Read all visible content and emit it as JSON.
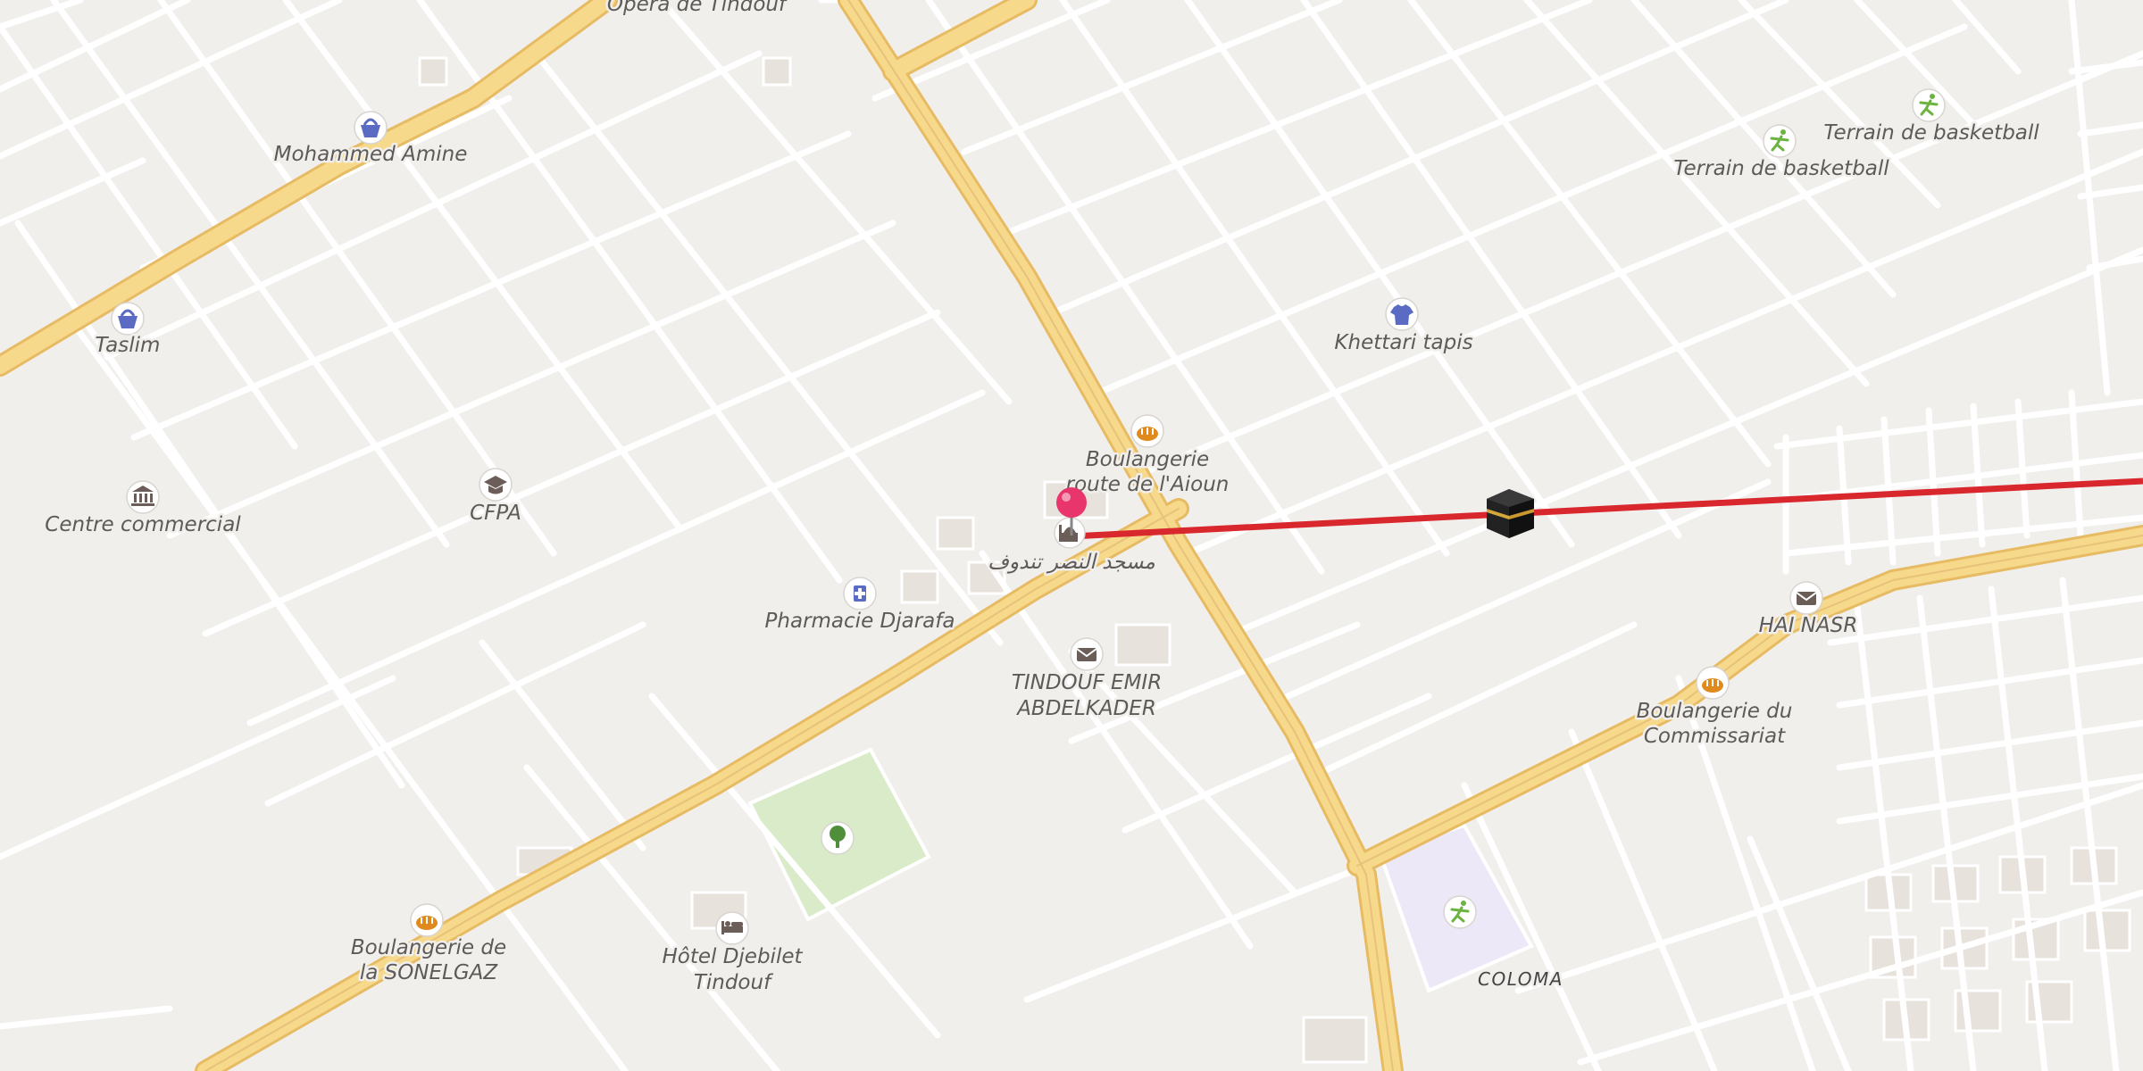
{
  "map": {
    "colors": {
      "background": "#f1efec",
      "minor_road": "#ffffff",
      "major_road": "#f7d98c",
      "major_road_casing": "#e6bb63",
      "route_line": "#d9272e",
      "park": "#d9ebc8",
      "sports_area": "#ece8f8",
      "pin": "#e8356b",
      "shop_icon": "#5b6bc4",
      "bakery_icon": "#e08a1e",
      "sport_icon": "#6cb33f",
      "default_icon": "#6b5e58"
    },
    "road_labels": {
      "north_road": "Opéra de Tindouf"
    },
    "pois": {
      "mohammed_amine": {
        "label": "Mohammed Amine",
        "icon": "shopping-basket-icon"
      },
      "taslim": {
        "label": "Taslim",
        "icon": "shopping-basket-icon"
      },
      "centre_commercial": {
        "label": "Centre commercial",
        "icon": "bank-icon"
      },
      "cfpa": {
        "label": "CFPA",
        "icon": "graduation-cap-icon"
      },
      "boulangerie_aioun": {
        "label_line1": "Boulangerie",
        "label_line2": "route de l'Aioun",
        "icon": "bread-icon"
      },
      "mosque": {
        "label": "مسجد النصر تندوف",
        "icon": "mosque-icon"
      },
      "pharmacie": {
        "label": "Pharmacie Djarafa",
        "icon": "pharmacy-icon"
      },
      "post_emir": {
        "label_line1": "TINDOUF EMIR",
        "label_line2": "ABDELKADER",
        "icon": "mail-icon"
      },
      "khettari": {
        "label": "Khettari tapis",
        "icon": "tshirt-icon"
      },
      "basket1": {
        "label": "Terrain de basketball",
        "icon": "sport-icon"
      },
      "basket2": {
        "label": "Terrain de basketball",
        "icon": "sport-icon"
      },
      "hai_nasr": {
        "label": "HAI NASR",
        "icon": "mail-icon"
      },
      "boulangerie_commissariat": {
        "label_line1": "Boulangerie du",
        "label_line2": "Commissariat",
        "icon": "bread-icon"
      },
      "coloma": {
        "label": "COLOMA",
        "icon": "sport-icon"
      },
      "park": {
        "icon": "tree-icon"
      },
      "hotel": {
        "label_line1": "Hôtel Djebilet",
        "label_line2": "Tindouf",
        "icon": "bed-icon"
      },
      "boulangerie_sonelgaz": {
        "label_line1": "Boulangerie de",
        "label_line2": "la SONELGAZ",
        "icon": "bread-icon"
      },
      "kaaba": {
        "icon": "kaaba-icon"
      }
    },
    "markers": {
      "location_pin": {
        "icon": "map-pin-icon"
      }
    }
  }
}
